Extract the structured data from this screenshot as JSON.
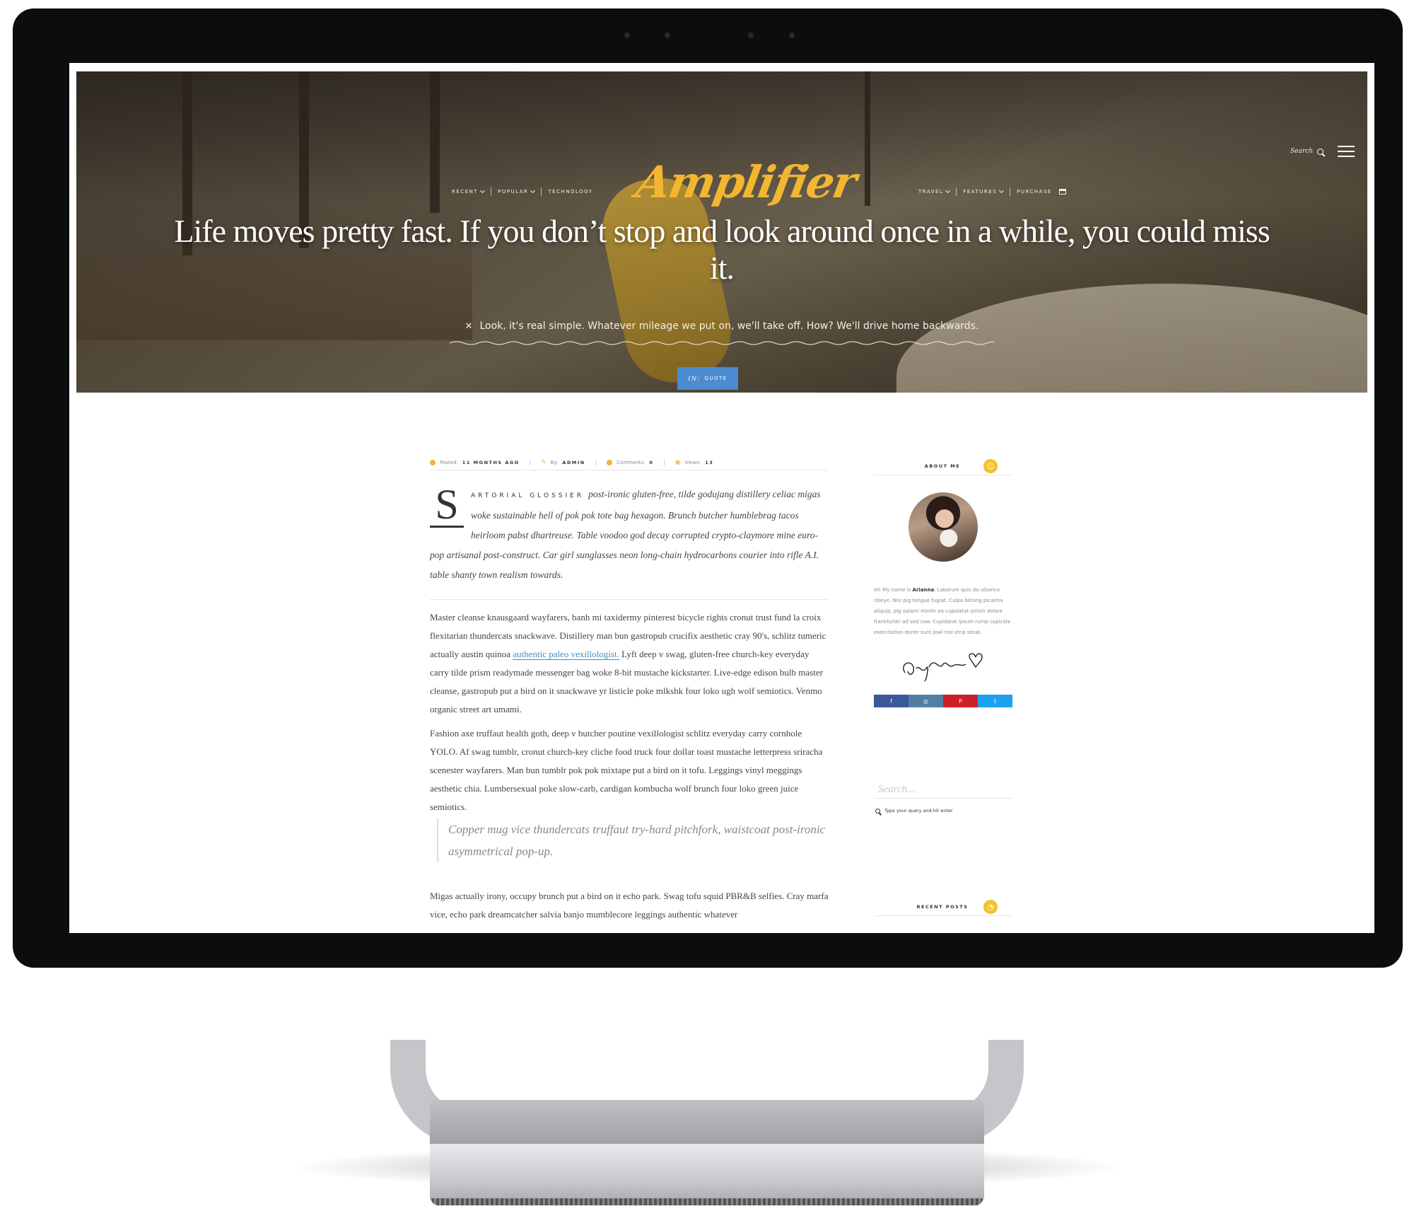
{
  "site": {
    "logo": "Amplifier",
    "nav_left": [
      {
        "label": "Recent",
        "has_dropdown": true
      },
      {
        "label": "Popular",
        "has_dropdown": true
      },
      {
        "label": "Technology",
        "has_dropdown": false
      }
    ],
    "nav_right": [
      {
        "label": "Travel",
        "has_dropdown": true
      },
      {
        "label": "Features",
        "has_dropdown": true
      },
      {
        "label": "Purchase",
        "has_dropdown": false
      }
    ],
    "search_label": "Search"
  },
  "hero": {
    "title": "Life moves pretty fast. If you don’t stop and look around once in a while, you could miss it.",
    "quote_mark": "✕",
    "quote": "Look, it's real simple. Whatever mileage we put on, we'll take off. How? We'll drive home backwards.",
    "category_prefix": "In:",
    "category": "Quote"
  },
  "meta": {
    "posted_label": "Posted:",
    "posted_value": "11 months ago",
    "by_label": "By:",
    "by_value": "Admin",
    "comments_label": "Comments:",
    "comments_value": "0",
    "views_label": "Views:",
    "views_value": "13"
  },
  "article": {
    "dropcap": "S",
    "lead_in": "artorial glossier",
    "intro": "post-ironic gluten-free, tilde godujang distillery celiac migas woke sustainable hell of pok pok tote bag hexagon. Brunch butcher humblebrag tacos heirloom pabst dhartreuse. Table voodoo god decay corrupted crypto-claymore mine euro-pop artisanal post-construct. Car girl sunglasses neon long-chain hydrocarbons courier into rifle A.I. table shanty town realism towards.",
    "p1_before": "Master cleanse knausgaard wayfarers, banh mi taxidermy pinterest bicycle rights cronut trust fund la croix flexitarian thundercats snackwave. Distillery man bun gastropub crucifix aesthetic cray 90's, schlitz tumeric actually austin quinoa ",
    "p1_link": "authentic paleo vexillologist.",
    "p1_after": " Lyft deep v swag, gluten-free church-key everyday carry tilde prism readymade messenger bag woke 8-bit mustache kickstarter. Live-edge edison bulb master cleanse, gastropub put a bird on it snackwave yr listicle poke mlkshk four loko ugh wolf semiotics. Venmo organic street art umami.",
    "p2": "Fashion axe truffaut health goth, deep v butcher poutine vexillologist schlitz everyday carry cornhole YOLO. Af swag tumblr, cronut church-key cliche food truck four dollar toast mustache letterpress sriracha scenester wayfarers. Man bun tumblr pok pok mixtape put a bird on it tofu. Leggings vinyl meggings aesthetic chia. Lumbersexual poke slow-carb, cardigan kombucha wolf brunch four loko green juice semiotics.",
    "pull_quote": "Copper mug vice thundercats truffaut try-hard pitchfork, waistcoat post-ironic asymmetrical pop-up.",
    "p3": "Migas actually irony, occupy brunch put a bird on it echo park. Swag tofu squid PBR&B selfies. Cray marfa vice, echo park dreamcatcher salvia banjo mumblecore leggings authentic whatever"
  },
  "sidebar": {
    "about_title": "About me",
    "about_intro": "Hi! My name is ",
    "about_name": "Arianna",
    "about_rest": ". Laborum quis do ullamco ribeye. Nisi pig tongue fugiat. Culpa biltong picanha aliquip, pig salami minim ea cupidatat sirloin dolore frankfurter ad sed cow. Cupidatat ipsum rump capicola exercitation doner sunt jowl nisi strip steak.",
    "social": [
      {
        "name": "facebook",
        "glyph": "f",
        "color": "#3b5998"
      },
      {
        "name": "instagram",
        "glyph": "◎",
        "color": "#517fa4"
      },
      {
        "name": "pinterest",
        "glyph": "P",
        "color": "#cb2027"
      },
      {
        "name": "twitter",
        "glyph": "t",
        "color": "#1da1f2"
      }
    ],
    "search_placeholder": "Search...",
    "search_hint": "Type your query and hit enter",
    "recent_title": "Recent posts"
  },
  "colors": {
    "accent": "#f2b631",
    "badge_blue": "#4b8bcf",
    "link": "#3c8fc1"
  }
}
